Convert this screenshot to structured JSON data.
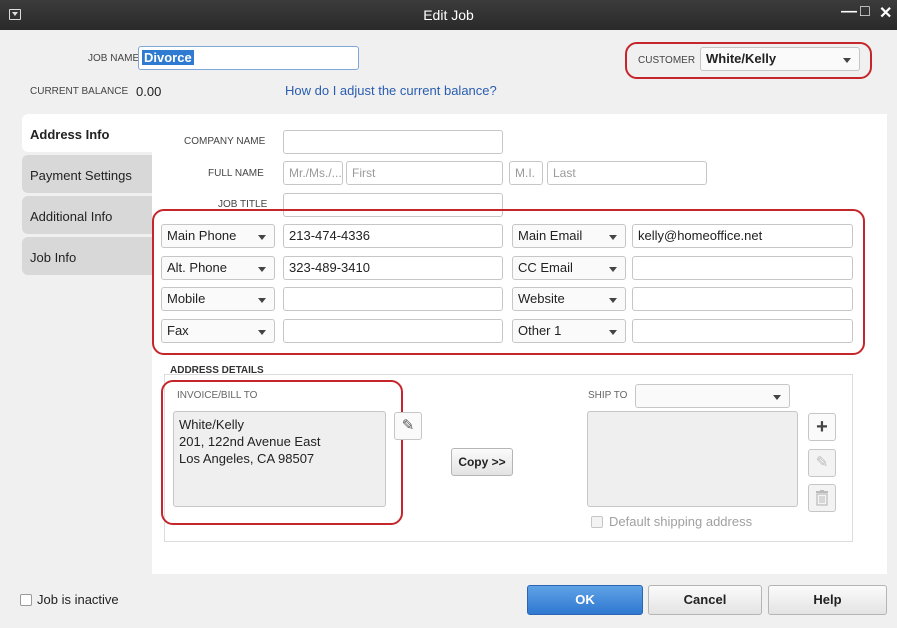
{
  "window": {
    "title": "Edit Job",
    "minimize": "—",
    "maximize": "□",
    "close": "✕"
  },
  "header": {
    "job_name_label": "JOB NAME",
    "job_name_value": "Divorce",
    "customer_label": "CUSTOMER",
    "customer_value": "White/Kelly",
    "balance_label": "CURRENT BALANCE",
    "balance_value": "0.00",
    "balance_link": "How do I adjust the current balance?"
  },
  "tabs": [
    {
      "label": "Address Info",
      "active": true
    },
    {
      "label": "Payment Settings"
    },
    {
      "label": "Additional Info"
    },
    {
      "label": "Job Info"
    }
  ],
  "form": {
    "company_label": "COMPANY NAME",
    "fullname_label": "FULL NAME",
    "title_prefix_ph": "Mr./Ms./...",
    "first_ph": "First",
    "mi_ph": "M.I.",
    "last_ph": "Last",
    "jobtitle_label": "JOB TITLE"
  },
  "contacts": {
    "left": [
      {
        "type": "Main Phone",
        "value": "213-474-4336"
      },
      {
        "type": "Alt. Phone",
        "value": "323-489-3410"
      },
      {
        "type": "Mobile",
        "value": ""
      },
      {
        "type": "Fax",
        "value": ""
      }
    ],
    "right": [
      {
        "type": "Main Email",
        "value": "kelly@homeoffice.net"
      },
      {
        "type": "CC Email",
        "value": ""
      },
      {
        "type": "Website",
        "value": ""
      },
      {
        "type": "Other 1",
        "value": ""
      }
    ]
  },
  "address": {
    "section_label": "ADDRESS DETAILS",
    "bill_label": "INVOICE/BILL TO",
    "bill_lines": [
      "White/Kelly",
      "201, 122nd Avenue East",
      "Los Angeles, CA 98507"
    ],
    "copy_button": "Copy >>",
    "ship_label": "SHIP TO",
    "ship_value": "",
    "default_shipping": "Default shipping address"
  },
  "footer": {
    "inactive_label": "Job is inactive",
    "ok": "OK",
    "cancel": "Cancel",
    "help": "Help"
  },
  "colors": {
    "highlight": "#c4262b",
    "primary": "#2f78d1",
    "link": "#2a5db0",
    "selection": "#2f7bd1"
  }
}
